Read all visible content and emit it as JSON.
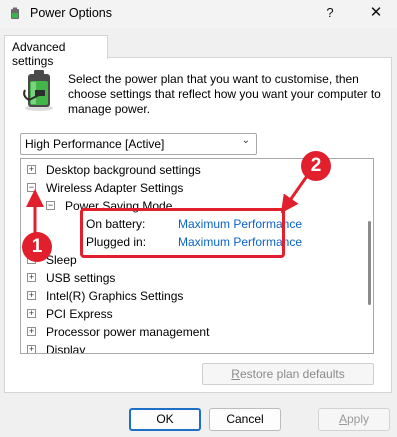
{
  "window": {
    "title": "Power Options",
    "help_glyph": "?",
    "close_glyph": "✕"
  },
  "tab": {
    "label": "Advanced settings"
  },
  "intro_text": "Select the power plan that you want to customise, then choose settings that reflect how you want your computer to manage power.",
  "plan_select": {
    "value": "High Performance [Active]"
  },
  "tree": {
    "items": [
      {
        "label": "Desktop background settings",
        "expander": "+"
      },
      {
        "label": "Wireless Adapter Settings",
        "expander": "−"
      },
      {
        "label": "Power Saving Mode",
        "expander": "−"
      },
      {
        "label": "On battery:",
        "value": "Maximum Performance"
      },
      {
        "label": "Plugged in:",
        "value": "Maximum Performance"
      },
      {
        "label": "Sleep",
        "expander": "+"
      },
      {
        "label": "USB settings",
        "expander": "+"
      },
      {
        "label": "Intel(R) Graphics Settings",
        "expander": "+"
      },
      {
        "label": "PCI Express",
        "expander": "+"
      },
      {
        "label": "Processor power management",
        "expander": "+"
      },
      {
        "label": "Display",
        "expander": "+"
      }
    ]
  },
  "annotations": {
    "marker_1": "1",
    "marker_2": "2",
    "color": "#e2202d"
  },
  "buttons": {
    "restore_prefix": "R",
    "restore_rest": "estore plan defaults",
    "ok": "OK",
    "cancel": "Cancel",
    "apply_prefix": "A",
    "apply_rest": "pply"
  }
}
